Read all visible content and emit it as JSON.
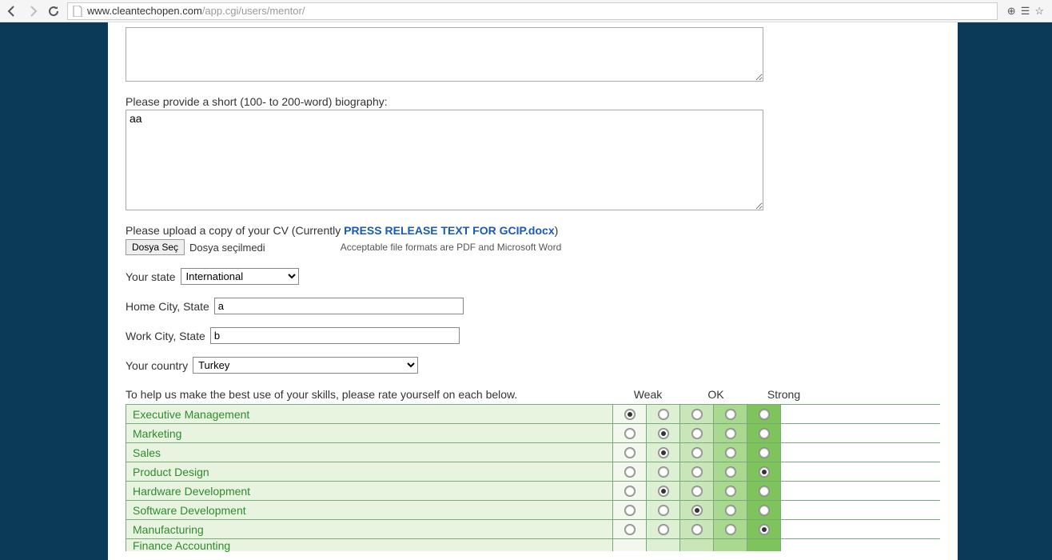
{
  "browser": {
    "url_domain": "www.cleantechopen.com",
    "url_path": "/app.cgi/users/mentor/"
  },
  "form": {
    "textarea1_value": "",
    "bio_label": "Please provide a short (100- to 200-word) biography:",
    "bio_value": "aa",
    "upload_label_prefix": "Please upload a copy of your CV (Currently ",
    "upload_filename": "PRESS RELEASE TEXT FOR GCIP.docx",
    "upload_label_suffix": ")",
    "file_btn": "Dosya Seç",
    "file_status": "Dosya seçilmedi",
    "file_hint": "Acceptable file formats are PDF and Microsoft Word",
    "state_label": "Your state",
    "state_value": "International",
    "home_label": "Home City, State",
    "home_value": "a",
    "work_label": "Work City, State",
    "work_value": "b",
    "country_label": "Your country",
    "country_value": "Turkey"
  },
  "skills": {
    "intro": "To help us make the best use of your skills, please rate yourself on each below.",
    "headers": {
      "weak": "Weak",
      "ok": "OK",
      "strong": "Strong"
    },
    "rows": [
      {
        "name": "Executive Management",
        "selected": 0
      },
      {
        "name": "Marketing",
        "selected": 1
      },
      {
        "name": "Sales",
        "selected": 1
      },
      {
        "name": "Product Design",
        "selected": 4
      },
      {
        "name": "Hardware Development",
        "selected": 1
      },
      {
        "name": "Software Development",
        "selected": 2
      },
      {
        "name": "Manufacturing",
        "selected": 4
      },
      {
        "name": "Finance Accounting",
        "selected": -1
      }
    ]
  }
}
